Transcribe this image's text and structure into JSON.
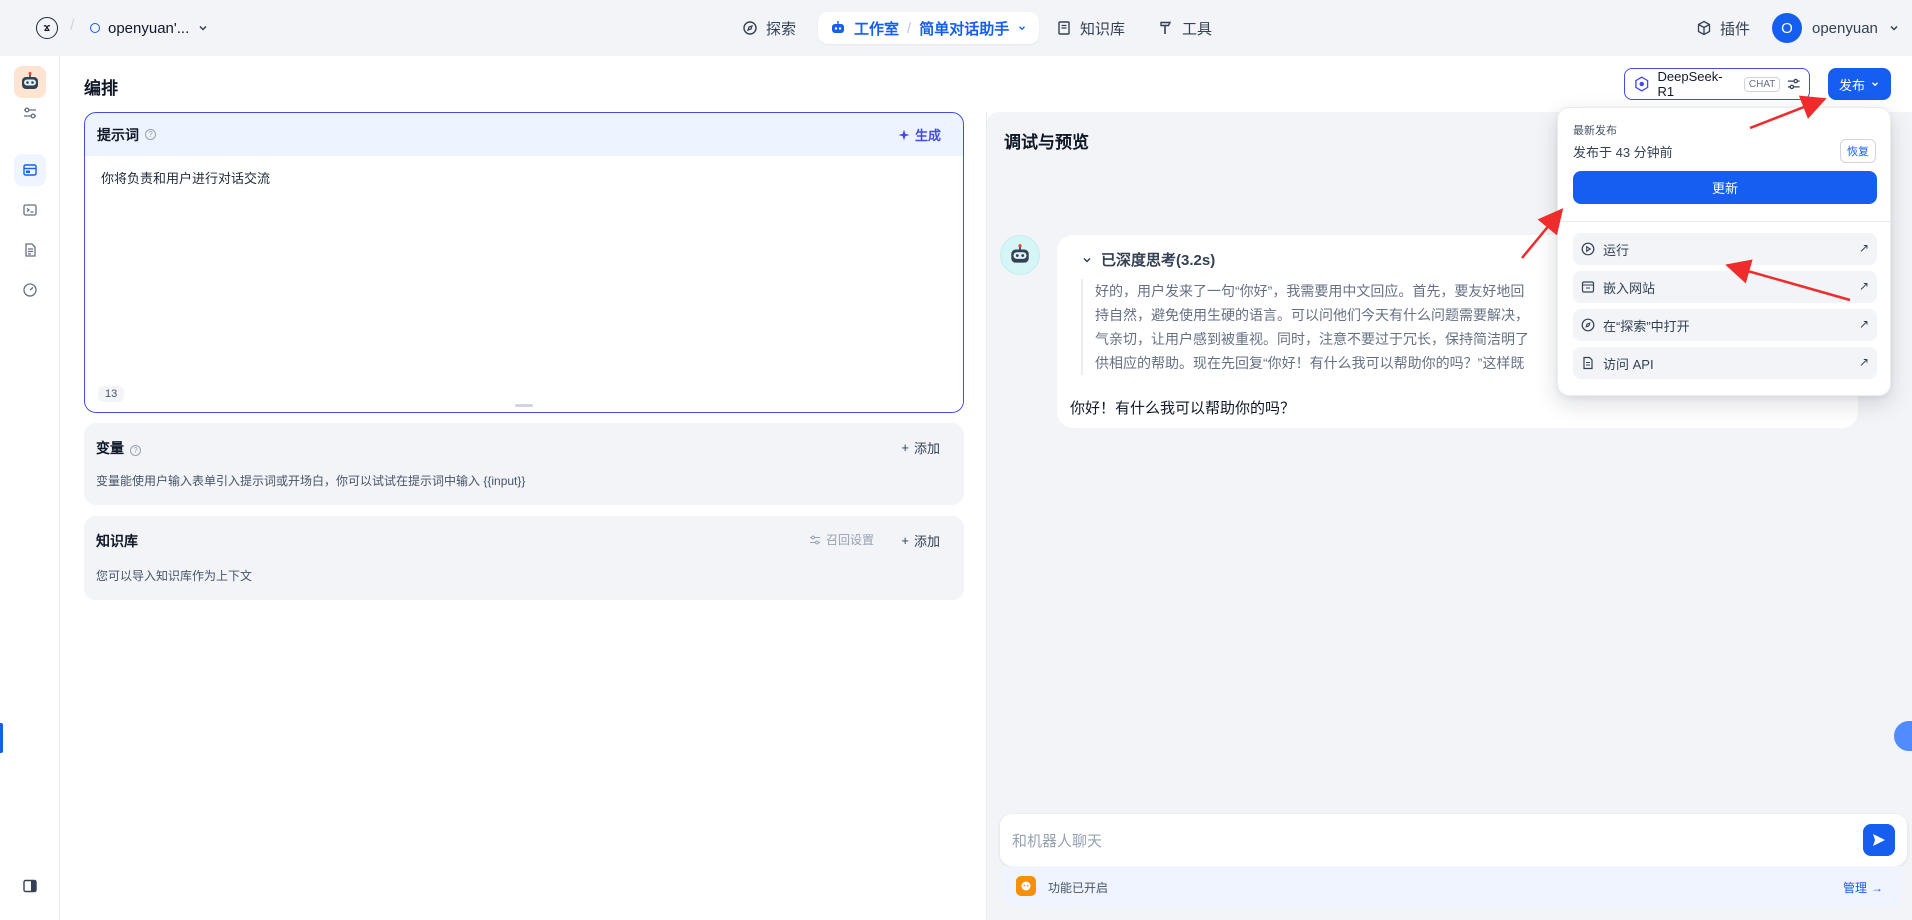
{
  "topbar": {
    "workspace": "openyuan'...",
    "nav": {
      "explore": "探索",
      "studio": "工作室",
      "app_name": "简单对话助手",
      "knowledge": "知识库",
      "tools": "工具"
    },
    "plugins": "插件",
    "user": {
      "initial": "O",
      "name": "openyuan"
    }
  },
  "left_rail": {
    "icons": [
      "robot-avatar",
      "settings-sliders-icon",
      "layout-icon",
      "terminal-icon",
      "file-list-icon",
      "dashboard-icon",
      "sidebar-toggle-icon"
    ]
  },
  "editor": {
    "title": "编排",
    "prompt": {
      "label": "提示词",
      "generate": "生成",
      "text": "你将负责和用户进行对话交流",
      "char_count": "13"
    },
    "variables": {
      "label": "变量",
      "add": "添加",
      "desc": "变量能使用户输入表单引入提示词或开场白，你可以试试在提示词中输入 {{input}}"
    },
    "knowledge": {
      "label": "知识库",
      "recall": "召回设置",
      "add": "添加",
      "desc": "您可以导入知识库作为上下文"
    }
  },
  "header_controls": {
    "model": "DeepSeek-R1",
    "model_tag": "CHAT",
    "publish": "发布"
  },
  "debug": {
    "title": "调试与预览",
    "thinking_label": "已深度思考(3.2s)",
    "thinking_lines": [
      "好的，用户发来了一句“你好”，我需要用中文回应。首先，要友好地回",
      "持自然，避免使用生硬的语言。可以问他们今天有什么问题需要解决，",
      "气亲切，让用户感到被重视。同时，注意不要过于冗长，保持简洁明了",
      "供相应的帮助。现在先回复“你好！有什么我可以帮助你的吗？”这样既"
    ],
    "answer": "你好！有什么我可以帮助你的吗？",
    "input_placeholder": "和机器人聊天",
    "features_enabled": "功能已开启",
    "manage": "管理"
  },
  "publish_menu": {
    "latest_label": "最新发布",
    "published_time": "发布于 43 分钟前",
    "restore": "恢复",
    "update": "更新",
    "items": [
      "运行",
      "嵌入网站",
      "在“探索”中打开",
      "访问 API"
    ]
  },
  "colors": {
    "accent": "#155eef",
    "prompt_border": "#444ce7",
    "annotation_arrow": "#ef2b2b"
  }
}
